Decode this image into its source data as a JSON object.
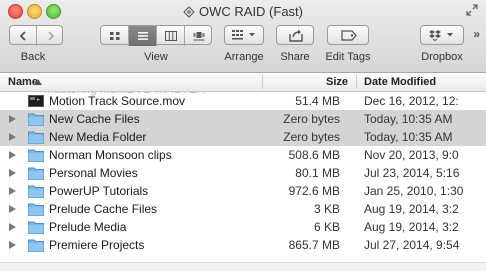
{
  "window": {
    "title": "OWC RAID (Fast)"
  },
  "toolbar": {
    "back_label": "Back",
    "view_label": "View",
    "arrange_label": "Arrange",
    "share_label": "Share",
    "edit_tags_label": "Edit Tags",
    "dropbox_label": "Dropbox"
  },
  "columns": {
    "name": "Name",
    "size": "Size",
    "date": "Date Modified"
  },
  "ghost_row": {
    "name": "Mastering Mu...DVD MASTER"
  },
  "rows": [
    {
      "name": "Motion Track Source.mov",
      "size": "51.4 MB",
      "date": "Dec 16, 2012, 12:",
      "icon": "movie-file-icon",
      "disclosure": false,
      "selected": false
    },
    {
      "name": "New Cache Files",
      "size": "Zero bytes",
      "date": "Today, 10:35 AM",
      "icon": "folder-icon",
      "disclosure": true,
      "selected": true
    },
    {
      "name": "New Media Folder",
      "size": "Zero bytes",
      "date": "Today, 10:35 AM",
      "icon": "folder-icon",
      "disclosure": true,
      "selected": true
    },
    {
      "name": "Norman Monsoon clips",
      "size": "508.6 MB",
      "date": "Nov 20, 2013, 9:0",
      "icon": "folder-icon",
      "disclosure": true,
      "selected": false
    },
    {
      "name": "Personal Movies",
      "size": "80.1 MB",
      "date": "Jul 23, 2014, 5:16",
      "icon": "folder-icon",
      "disclosure": true,
      "selected": false
    },
    {
      "name": "PowerUP Tutorials",
      "size": "972.6 MB",
      "date": "Jan 25, 2010, 1:30",
      "icon": "folder-icon",
      "disclosure": true,
      "selected": false
    },
    {
      "name": "Prelude Cache Files",
      "size": "3 KB",
      "date": "Aug 19, 2014, 3:2",
      "icon": "folder-icon",
      "disclosure": true,
      "selected": false
    },
    {
      "name": "Prelude Media",
      "size": "6 KB",
      "date": "Aug 19, 2014, 3:2",
      "icon": "folder-icon",
      "disclosure": true,
      "selected": false
    },
    {
      "name": "Premiere Projects",
      "size": "865.7 MB",
      "date": "Jul 27, 2014, 9:54",
      "icon": "folder-icon",
      "disclosure": true,
      "selected": false
    }
  ]
}
